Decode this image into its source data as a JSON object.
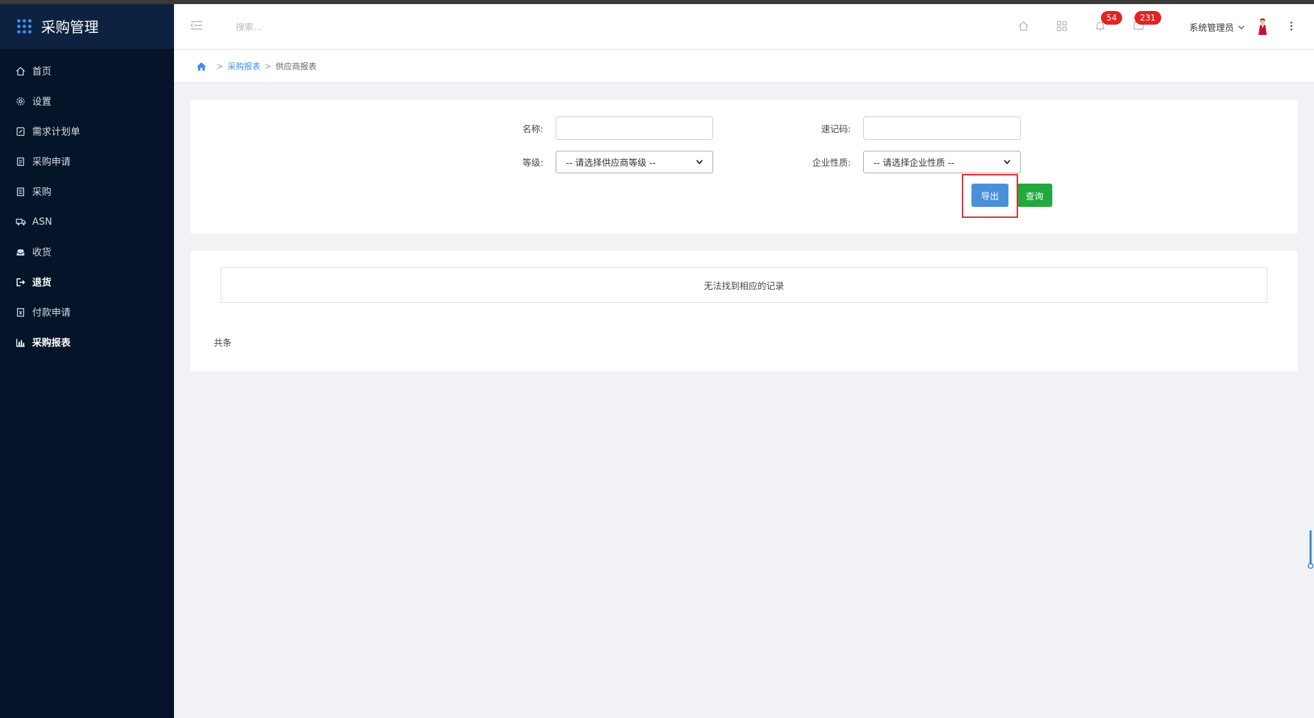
{
  "app": {
    "title": "采购管理",
    "brand_color": "#3b8df0"
  },
  "sidebar": {
    "items": [
      {
        "label": "首页",
        "icon": "home-icon"
      },
      {
        "label": "设置",
        "icon": "gear-icon"
      },
      {
        "label": "需求计划单",
        "icon": "edit-doc-icon"
      },
      {
        "label": "采购申请",
        "icon": "document-icon"
      },
      {
        "label": "采购",
        "icon": "list-doc-icon"
      },
      {
        "label": "ASN",
        "icon": "truck-icon"
      },
      {
        "label": "收货",
        "icon": "inbox-icon"
      },
      {
        "label": "退货",
        "icon": "sign-out-icon"
      },
      {
        "label": "付款申请",
        "icon": "payment-doc-icon"
      },
      {
        "label": "采购报表",
        "icon": "bar-chart-icon"
      }
    ]
  },
  "header": {
    "search_placeholder": "搜索...",
    "notifications_count": "54",
    "messages_count": "231",
    "user_name": "系统管理员"
  },
  "breadcrumb": {
    "parent": "采购报表",
    "current": "供应商报表",
    "separator": ">"
  },
  "filters": {
    "name_label": "名称:",
    "code_label": "速记码:",
    "grade_label": "等级:",
    "grade_selected": "-- 请选择供应商等级 --",
    "nature_label": "企业性质:",
    "nature_selected": "-- 请选择企业性质 --",
    "export_label": "导出",
    "query_label": "查询"
  },
  "results": {
    "empty_text": "无法找到相应的记录",
    "total_text": "共条"
  },
  "colors": {
    "sidebar_bg": "#051429",
    "export_btn": "#4a90d9",
    "query_btn": "#22a83c",
    "badge": "#e02424",
    "highlight": "#e0282d"
  }
}
